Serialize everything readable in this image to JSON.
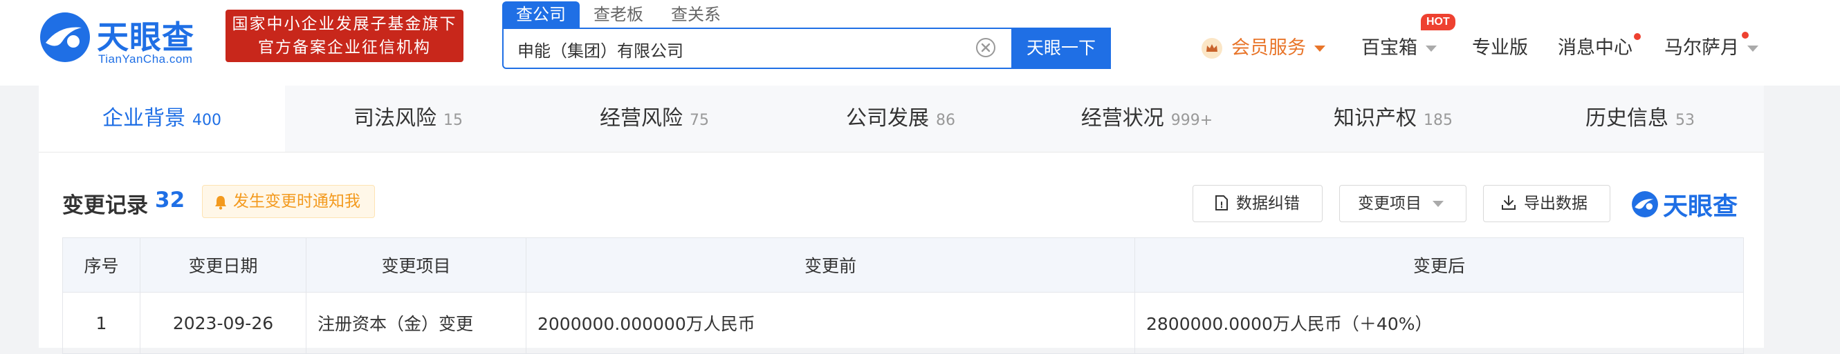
{
  "header": {
    "logo_text": "天眼查",
    "logo_sub": "TianYanCha.com",
    "gov_badge_line1": "国家中小企业发展子基金旗下",
    "gov_badge_line2": "官方备案企业征信机构",
    "search_tabs": [
      "查公司",
      "查老板",
      "查关系"
    ],
    "search_value": "申能（集团）有限公司",
    "search_button": "天眼一下",
    "nav": {
      "vip": "会员服务",
      "box": "百宝箱",
      "hot": "HOT",
      "pro": "专业版",
      "msg": "消息中心",
      "user": "马尔萨月"
    }
  },
  "tabs": [
    {
      "label": "企业背景",
      "count": "400"
    },
    {
      "label": "司法风险",
      "count": "15"
    },
    {
      "label": "经营风险",
      "count": "75"
    },
    {
      "label": "公司发展",
      "count": "86"
    },
    {
      "label": "经营状况",
      "count": "999+"
    },
    {
      "label": "知识产权",
      "count": "185"
    },
    {
      "label": "历史信息",
      "count": "53"
    }
  ],
  "section": {
    "title": "变更记录",
    "count": "32",
    "notify": "发生变更时通知我",
    "fix_button": "数据纠错",
    "item_filter": "变更项目",
    "export_button": "导出数据",
    "brand": "天眼查"
  },
  "table": {
    "headers": [
      "序号",
      "变更日期",
      "变更项目",
      "变更前",
      "变更后"
    ],
    "rows": [
      [
        "1",
        "2023-09-26",
        "注册资本（金）变更",
        "2000000.000000万人民币",
        "2800000.0000万人民币（＋40%）"
      ]
    ]
  },
  "colors": {
    "brand_blue": "#1f6fe5",
    "badge_red": "#c8271b",
    "vip_orange": "#e8752a",
    "increase_red": "#e05545"
  }
}
